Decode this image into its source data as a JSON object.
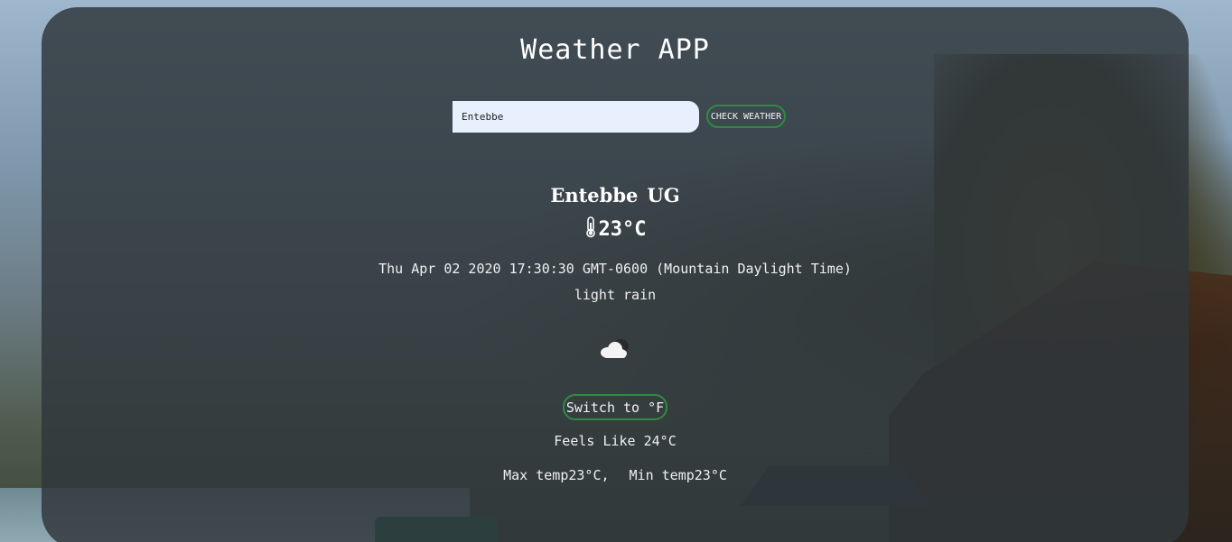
{
  "header": {
    "title": "Weather APP"
  },
  "search": {
    "value": "Entebbe",
    "button_label": "CHECK WEATHER"
  },
  "location": {
    "city": "Entebbe",
    "country": "UG"
  },
  "current": {
    "temperature": "23°C",
    "datetime": "Thu Apr 02 2020 17:30:30 GMT-0600 (Mountain Daylight Time)",
    "description": "light rain",
    "icon": "rain-cloud-icon"
  },
  "units": {
    "switch_label": "Switch to °F"
  },
  "details": {
    "feels_like_label": "Feels Like",
    "feels_like_value": "24°C",
    "max_label": "Max temp",
    "max_value": "23°C,",
    "min_label": "Min temp",
    "min_value": "23°C"
  },
  "colors": {
    "button_border": "#2f8b42",
    "input_bg": "#e8f0fe"
  }
}
